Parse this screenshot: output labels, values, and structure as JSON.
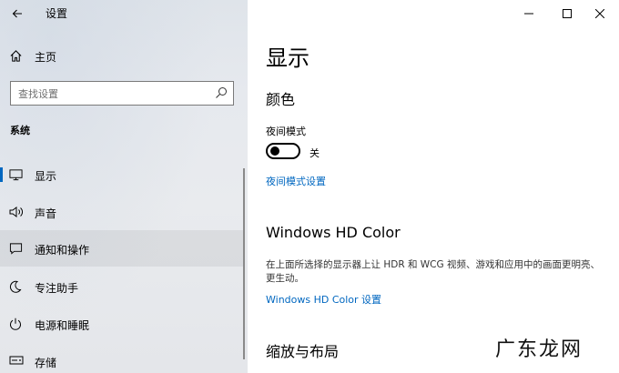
{
  "app": {
    "title": "设置"
  },
  "sidebar": {
    "home_label": "主页",
    "search": {
      "placeholder": "查找设置",
      "value": ""
    },
    "section_title": "系统",
    "items": [
      {
        "label": "显示",
        "icon": "monitor-icon",
        "selected": true
      },
      {
        "label": "声音",
        "icon": "speaker-icon"
      },
      {
        "label": "通知和操作",
        "icon": "notification-icon"
      },
      {
        "label": "专注助手",
        "icon": "moon-icon"
      },
      {
        "label": "电源和睡眠",
        "icon": "power-icon"
      },
      {
        "label": "存储",
        "icon": "storage-icon"
      }
    ]
  },
  "main": {
    "page_title": "显示",
    "color_section": {
      "heading": "颜色",
      "night_light_label": "夜间模式",
      "toggle_state": "关",
      "toggle_on": false,
      "settings_link": "夜间模式设置"
    },
    "hdr_section": {
      "heading": "Windows HD Color",
      "description": "在上面所选择的显示器上让 HDR 和 WCG 视频、游戏和应用中的画面更明亮、更生动。",
      "settings_link": "Windows HD Color 设置"
    },
    "scale_section": {
      "heading": "缩放与布局"
    }
  },
  "watermark": "广东龙网",
  "colors": {
    "accent": "#0067c0",
    "sidebar_bg": "#e6e9ee"
  }
}
